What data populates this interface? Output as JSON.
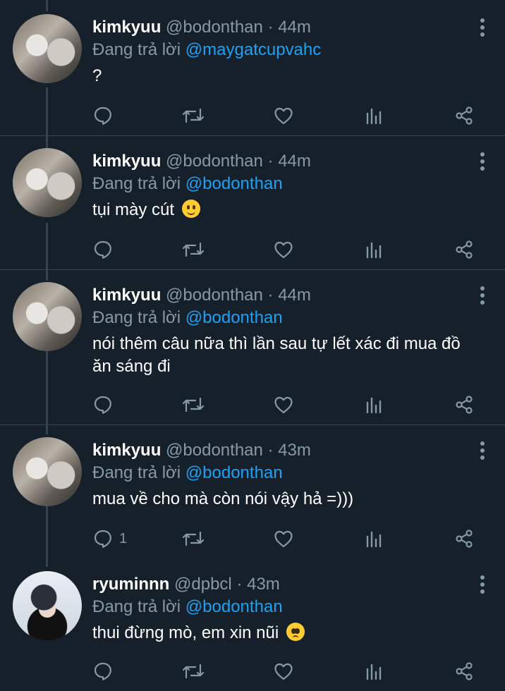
{
  "tweets": [
    {
      "name": "kimkyuu",
      "handle": "@bodonthan",
      "time": "44m",
      "reply_prefix": "Đang trả lời ",
      "reply_to": "@maygatcupvahc",
      "text": "?",
      "emoji": "",
      "reply_count": ""
    },
    {
      "name": "kimkyuu",
      "handle": "@bodonthan",
      "time": "44m",
      "reply_prefix": "Đang trả lời ",
      "reply_to": "@bodonthan",
      "text": "tụi mày cút",
      "emoji": "slightly-smiling-face",
      "reply_count": ""
    },
    {
      "name": "kimkyuu",
      "handle": "@bodonthan",
      "time": "44m",
      "reply_prefix": "Đang trả lời ",
      "reply_to": "@bodonthan",
      "text": "nói thêm câu nữa thì lần sau tự lết xác đi mua đồ ăn sáng đi",
      "emoji": "",
      "reply_count": ""
    },
    {
      "name": "kimkyuu",
      "handle": "@bodonthan",
      "time": "43m",
      "reply_prefix": "Đang trả lời ",
      "reply_to": "@bodonthan",
      "text": "mua về cho mà còn nói vậy hả =)))",
      "emoji": "",
      "reply_count": "1"
    },
    {
      "name": "ryuminnn",
      "handle": "@dpbcl",
      "time": "43m",
      "reply_prefix": "Đang trả lời ",
      "reply_to": "@bodonthan",
      "text": "thui đừng mò, em xin nũi",
      "emoji": "pleading-face",
      "reply_count": ""
    }
  ],
  "separator": "·",
  "icons": [
    "reply-icon",
    "retweet-icon",
    "like-icon",
    "analytics-icon",
    "share-icon",
    "more-options-icon"
  ],
  "colors": {
    "background": "#15202b",
    "text": "#ffffff",
    "muted": "#8899a6",
    "mention": "#1da1f2",
    "divider": "#38444d"
  }
}
